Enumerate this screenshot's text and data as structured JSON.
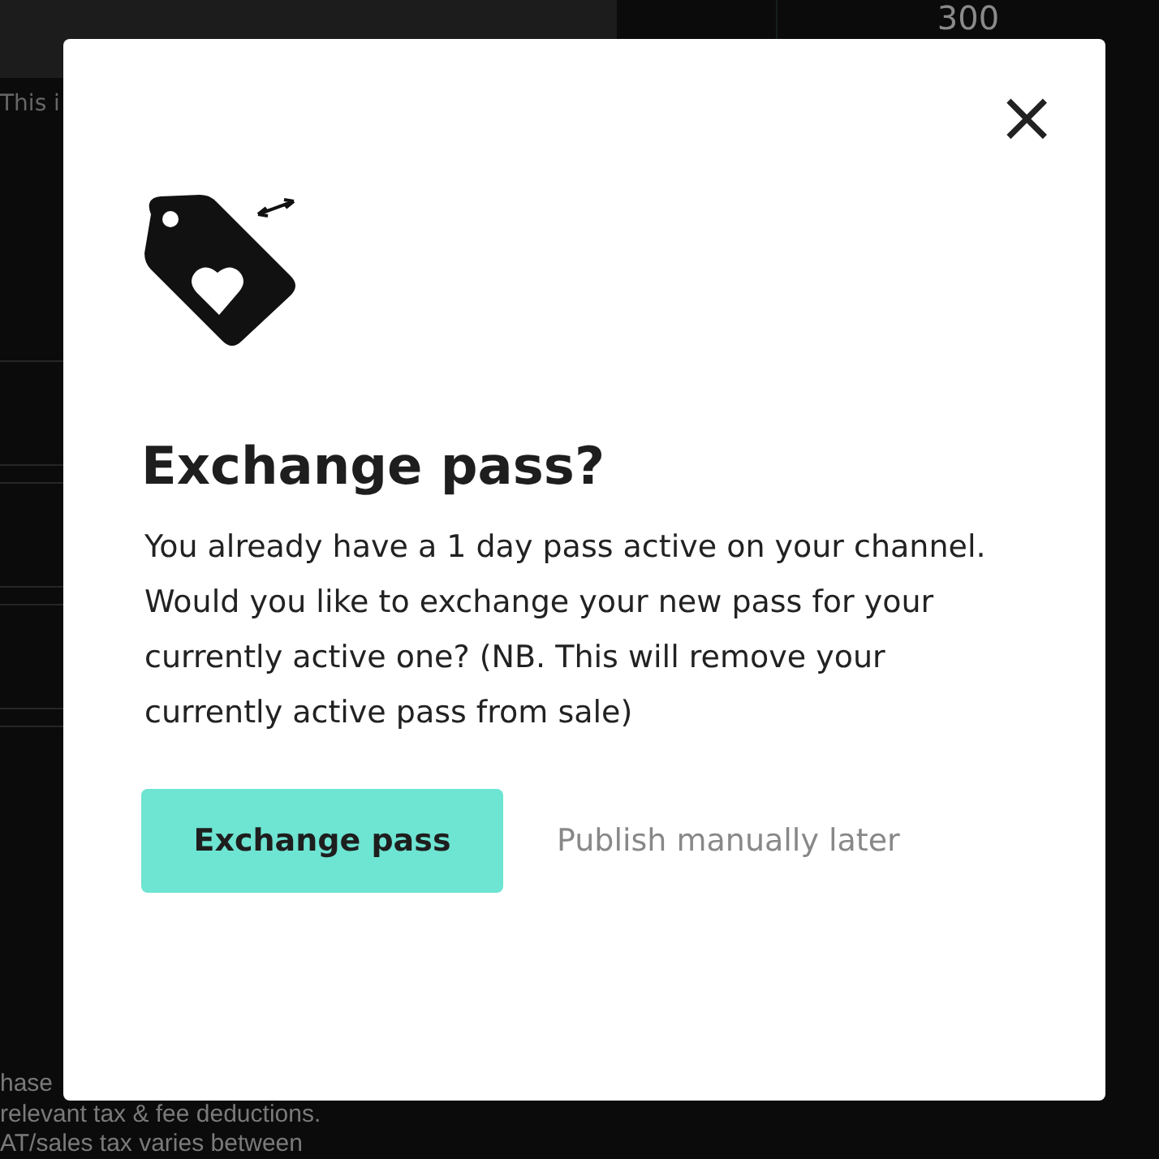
{
  "background": {
    "header_value": "300",
    "notice": "This i",
    "footer_lines": [
      "hase",
      "relevant tax & fee deductions.",
      "AT/sales tax varies between"
    ]
  },
  "dialog": {
    "close": "×",
    "title": "Exchange pass?",
    "message": "You already have a 1 day pass active on your channel. Would you like to exchange your new pass for your currently active one? (NB. This will remove your currently active pass from sale)",
    "primary_button": "Exchange pass",
    "secondary_link": "Publish manually later"
  }
}
